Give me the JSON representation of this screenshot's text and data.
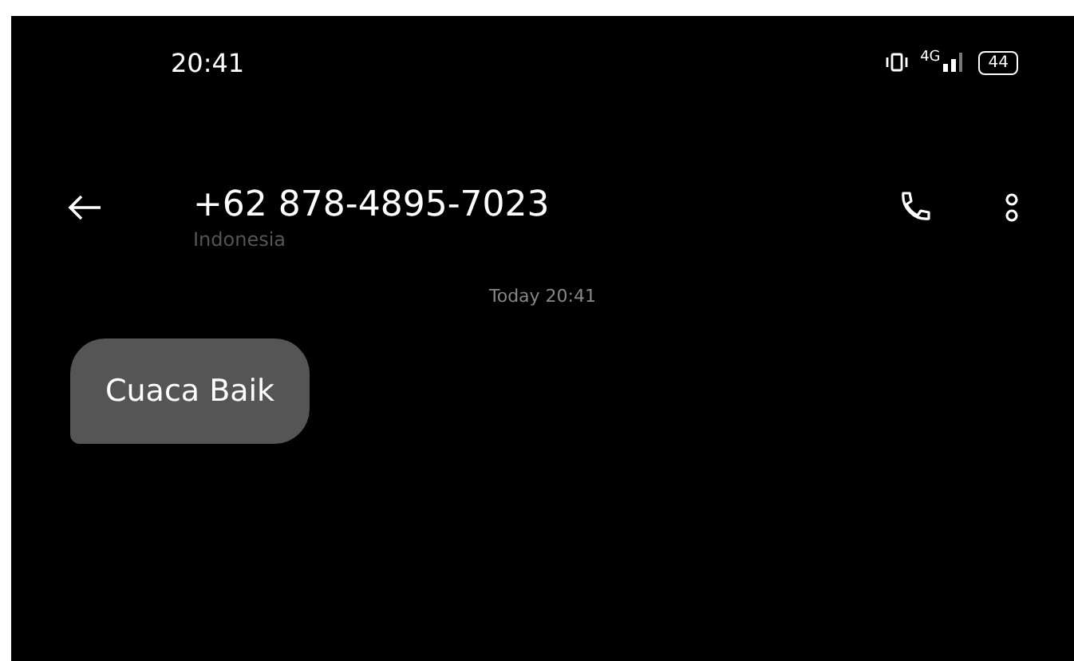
{
  "status_bar": {
    "time": "20:41",
    "network": "4G",
    "battery": "44"
  },
  "header": {
    "title": "+62 878-4895-7023",
    "subtitle": "Indonesia"
  },
  "messages": [
    {
      "kind": "timestamp",
      "text": "Today 20:41"
    },
    {
      "kind": "incoming",
      "text": "Cuaca Baik"
    }
  ]
}
